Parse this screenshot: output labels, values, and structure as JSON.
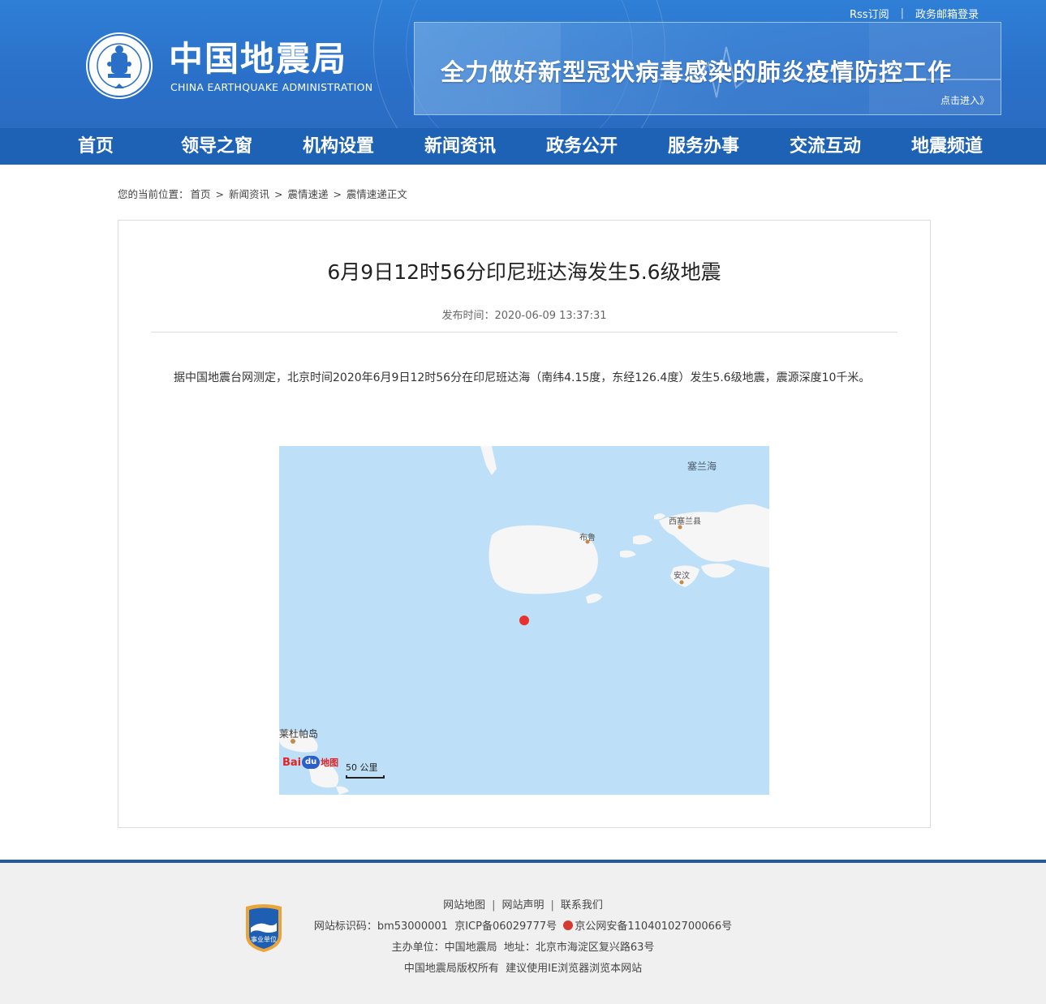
{
  "top_links": {
    "rss": "Rss订阅",
    "sep": "|",
    "mail": "政务邮箱登录"
  },
  "logo": {
    "title": "中国地震局",
    "subtitle": "CHINA EARTHQUAKE ADMINISTRATION",
    "emblem_icon": "cea-emblem-icon"
  },
  "banner": {
    "text": "全力做好新型冠状病毒感染的肺炎疫情防控工作",
    "enter": "点击进入》"
  },
  "nav": [
    "首页",
    "领导之窗",
    "机构设置",
    "新闻资讯",
    "政务公开",
    "服务办事",
    "交流互动",
    "地震频道"
  ],
  "breadcrumb": {
    "prefix": "您的当前位置：",
    "items": [
      "首页",
      "新闻资讯",
      "震情速递",
      "震情速递正文"
    ],
    "sep": ">"
  },
  "article": {
    "title": "6月9日12时56分印尼班达海发生5.6级地震",
    "meta": "发布时间：2020-06-09 13:37:31",
    "body": "据中国地震台网测定，北京时间2020年6月9日12时56分在印尼班达海（南纬4.15度，东经126.4度）发生5.6级地震，震源深度10千米。"
  },
  "map": {
    "labels": {
      "sea": "塞兰海",
      "west_seram": "西塞兰县",
      "buru": "布鲁",
      "ambon": "安汶",
      "leti": "莱杜帕岛"
    },
    "scale": "50 公里",
    "logo": {
      "bai": "Bai",
      "du": "du",
      "ditu": "地图"
    },
    "colors": {
      "sea": "#bde0f8",
      "land": "#f6f6f6",
      "epicenter": "#e8302c"
    }
  },
  "footer": {
    "links": [
      "网站地图",
      "网站声明",
      "联系我们"
    ],
    "sep": "|",
    "line2": {
      "site_id": "网站标识码：bm53000001",
      "icp": "京ICP备06029777号",
      "police": "京公网安备11040102700066号"
    },
    "line3": {
      "host": "主办单位：中国地震局",
      "addr": "地址：北京市海淀区复兴路63号"
    },
    "line4": {
      "copy": "中国地震局版权所有",
      "advice": "建议使用IE浏览器浏览本网站"
    },
    "badge": "事业单位"
  }
}
